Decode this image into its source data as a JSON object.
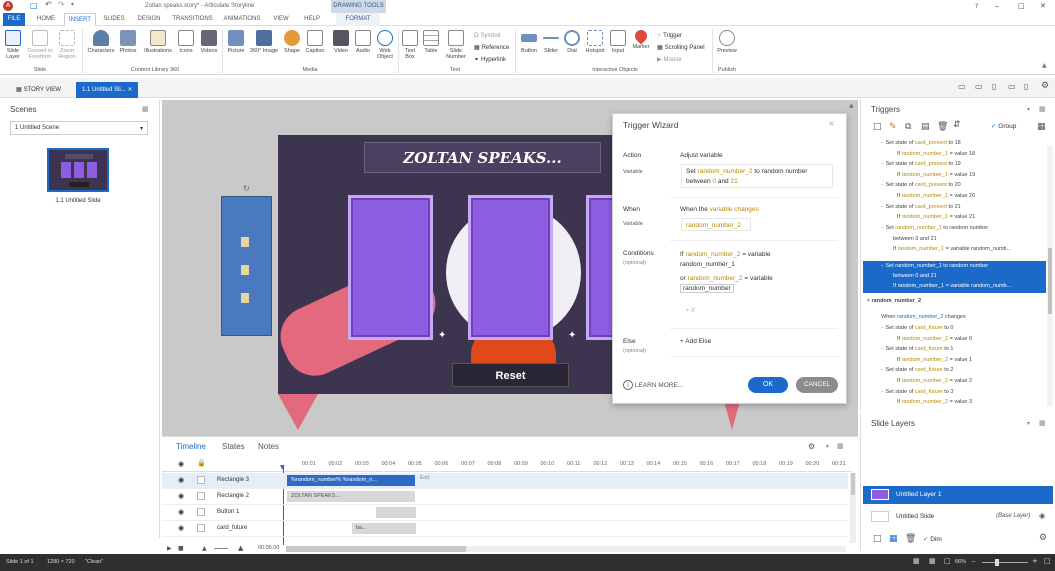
{
  "app": {
    "title": "Zoltan speaks.story* - Articulate Storyline",
    "drawing_tools": "DRAWING TOOLS"
  },
  "ribbon_tabs": [
    "FILE",
    "HOME",
    "INSERT",
    "SLIDES",
    "DESIGN",
    "TRANSITIONS",
    "ANIMATIONS",
    "VIEW",
    "HELP",
    "FORMAT"
  ],
  "ribbon": {
    "slide_layer": "Slide Layer",
    "convert_freeform": "Convert to Freeform",
    "zoom_region": "Zoom Region",
    "group_slide": "Slide",
    "characters": "Characters",
    "photos": "Photos",
    "illustrations": "Illustrations",
    "icons": "Icons",
    "videos": "Videos",
    "group_content": "Content Library 360",
    "picture": "Picture",
    "image360": "360° Image",
    "shape": "Shape",
    "caption": "Caption",
    "video": "Video",
    "audio": "Audio",
    "web_object": "Web Object",
    "group_media": "Media",
    "text_box": "Text Box",
    "table": "Table",
    "slide_number": "Slide Number",
    "symbol": "Symbol",
    "reference": "Reference",
    "hyperlink": "Hyperlink",
    "group_text": "Text",
    "button": "Button",
    "slider": "Slider",
    "dial": "Dial",
    "hotspot": "Hotspot",
    "input": "Input",
    "marker": "Marker",
    "trigger": "Trigger",
    "scrolling_panel": "Scrolling Panel",
    "mouse": "Mouse",
    "group_interactive": "Interactive Objects",
    "preview": "Preview",
    "group_publish": "Publish"
  },
  "viewbar": {
    "story_view": "STORY VIEW",
    "slide_tab": "1.1 Untitled Sli..."
  },
  "scenes": {
    "title": "Scenes",
    "dropdown": "1 Untitled Scene",
    "thumb_label": "1.1 Untitled Slide"
  },
  "stage": {
    "banner": "ZOLTAN SPEAKS...",
    "reset": "Reset"
  },
  "wizard": {
    "title": "Trigger Wizard",
    "action_label": "Action",
    "action_value": "Adjust variable",
    "variable_label": "Variable",
    "variable_text_1": "Set",
    "variable_var": "random_number_2",
    "variable_text_2": "to random number",
    "variable_text_3": "between",
    "variable_min": "0",
    "variable_and": "and",
    "variable_max": "21",
    "when_label": "When",
    "when_text_1": "When the",
    "when_link": "variable changes",
    "when_variable_label": "Variable",
    "when_variable_value": "random_number_2",
    "conditions_label": "Conditions",
    "conditions_sub": "(optional)",
    "cond1_if": "If",
    "cond1_var": "random_number_2",
    "cond1_op": "= variable",
    "cond1_val": "random_number_1",
    "cond2_or": "or",
    "cond2_var": "random_number_2",
    "cond2_op": "= variable",
    "cond2_val": "random_number",
    "add_if": "+ If",
    "else_label": "Else",
    "else_sub": "(optional)",
    "add_else": "+ Add Else",
    "learn_more": "LEARN MORE...",
    "ok": "OK",
    "cancel": "CANCEL"
  },
  "triggers": {
    "title": "Triggers",
    "group": "Group",
    "rows": [
      {
        "a": "Set state of ",
        "v": "card_present",
        "b": " to 18",
        "indent": 1
      },
      {
        "a": "If ",
        "v": "random_number_1",
        "b": " = value 18",
        "indent": 2
      },
      {
        "a": "Set state of ",
        "v": "card_present",
        "b": " to 19",
        "indent": 1
      },
      {
        "a": "If ",
        "v": "random_number_1",
        "b": " = value 19",
        "indent": 2
      },
      {
        "a": "Set state of ",
        "v": "card_present",
        "b": " to 20",
        "indent": 1
      },
      {
        "a": "If ",
        "v": "random_number_1",
        "b": " = value 20",
        "indent": 2
      },
      {
        "a": "Set state of ",
        "v": "card_present",
        "b": " to 21",
        "indent": 1
      },
      {
        "a": "If ",
        "v": "random_number_1",
        "b": " = value 21",
        "indent": 2
      },
      {
        "a": "Set ",
        "v": "random_number_1",
        "b": " to random number",
        "indent": 1
      },
      {
        "a": "between 0 and 21",
        "v": "",
        "b": "",
        "indent": 2
      },
      {
        "a": "If ",
        "v": "random_number_1",
        "b": " = variable random_numb...",
        "indent": 2
      }
    ],
    "selected_rows": [
      {
        "a": "Set ",
        "v": "random_number_1",
        "b": " to random number"
      },
      {
        "a": "between 0 and 21",
        "v": "",
        "b": ""
      },
      {
        "a": "If ",
        "v": "random_number_1",
        "b": " = variable random_numb..."
      }
    ],
    "section2": "random_number_2",
    "when_row_a": "When ",
    "when_row_v": "random_number_2",
    "when_row_b": " changes",
    "rows2": [
      {
        "a": "Set state of ",
        "v": "card_future",
        "b": " to 0",
        "indent": 1
      },
      {
        "a": "If ",
        "v": "random_number_2",
        "b": " = value 0",
        "indent": 2
      },
      {
        "a": "Set state of ",
        "v": "card_future",
        "b": " to 1",
        "indent": 1
      },
      {
        "a": "If ",
        "v": "random_number_2",
        "b": " = value 1",
        "indent": 2
      },
      {
        "a": "Set state of ",
        "v": "card_future",
        "b": " to 2",
        "indent": 1
      },
      {
        "a": "If ",
        "v": "random_number_2",
        "b": " = value 2",
        "indent": 2
      },
      {
        "a": "Set state of ",
        "v": "card_future",
        "b": " to 3",
        "indent": 1
      },
      {
        "a": "If ",
        "v": "random_number_2",
        "b": " = value 3",
        "indent": 2
      }
    ]
  },
  "layers": {
    "title": "Slide Layers",
    "layer1": "Untitled Layer 1",
    "base": "Untitled Slide",
    "base_tag": "(Base Layer)",
    "dim": "Dim"
  },
  "timeline": {
    "tabs": [
      "Timeline",
      "States",
      "Notes"
    ],
    "ticks": [
      "00:01",
      "00:02",
      "00:03",
      "00:04",
      "00:05",
      "00:06",
      "00:07",
      "00:08",
      "00:09",
      "00:10",
      "00:11",
      "00:12",
      "00:13",
      "00:14",
      "00:15",
      "00:16",
      "00:17",
      "00:18",
      "00:19",
      "00:20",
      "00:21"
    ],
    "rows": [
      {
        "name": "Rectangle 3",
        "bar": "%random_number% %random_n..."
      },
      {
        "name": "Rectangle 2",
        "bar": "ZOLTAN SPEAKS..."
      },
      {
        "name": "Button 1",
        "bar": ""
      },
      {
        "name": "card_future",
        "bar": "ba..."
      }
    ],
    "end_label": "End",
    "time": "00:05.00"
  },
  "status": {
    "slide": "Slide 1 of 1",
    "size": "1280 × 720",
    "theme": "\"Clean\"",
    "zoom": "66%"
  },
  "colors": {
    "accent": "#1b6ac9",
    "stage_bg": "#3d3550",
    "card": "#8e5ee0",
    "highlight": "#b98a00",
    "ok_button": "#1b6ac9"
  }
}
